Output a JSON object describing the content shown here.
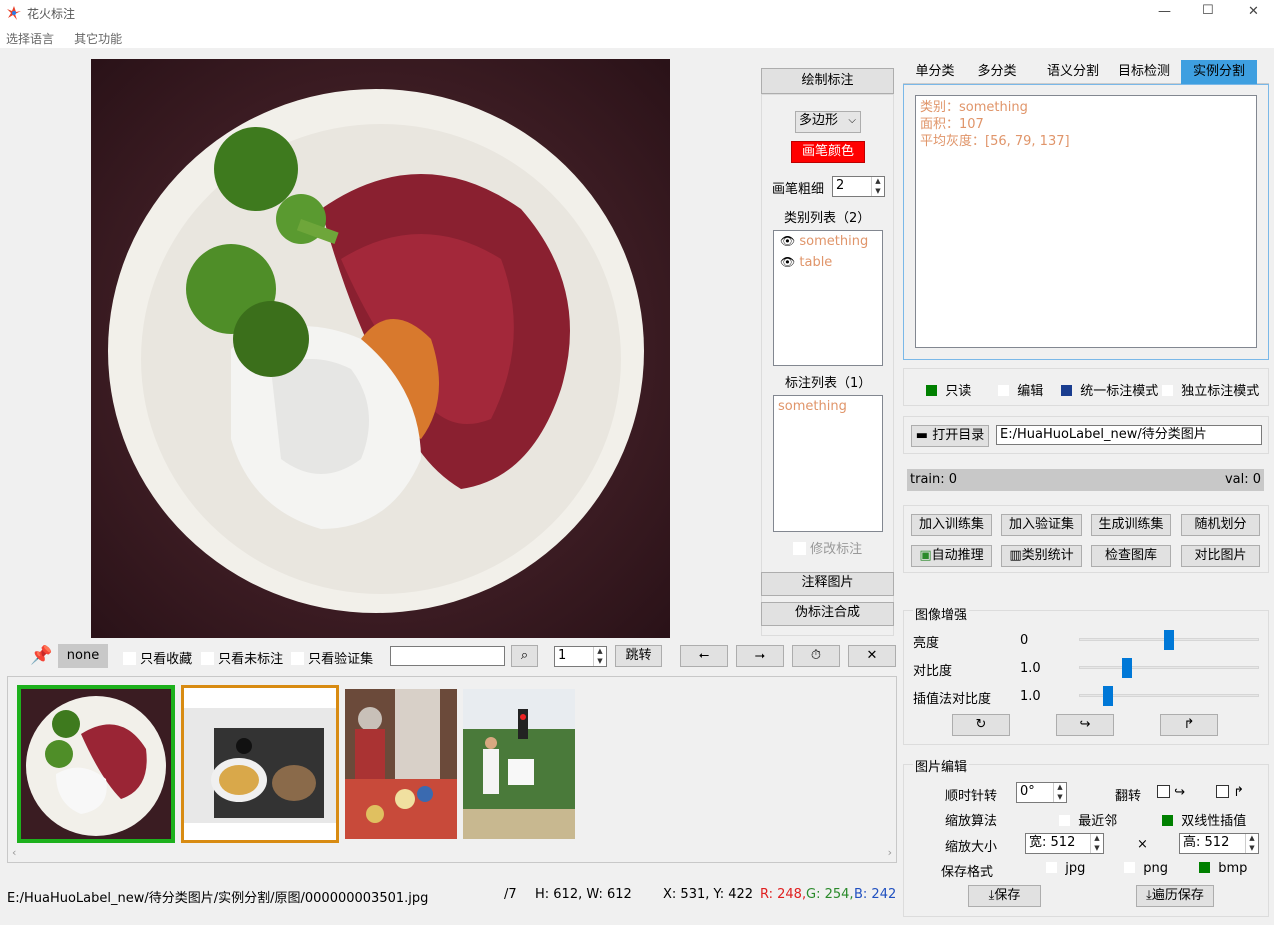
{
  "window": {
    "title": "花火标注",
    "minimize": "—",
    "maximize": "☐",
    "close": "✕"
  },
  "menu": {
    "language": "选择语言",
    "other": "其它功能"
  },
  "draw_panel": {
    "header": "绘制标注",
    "shape": "多边形",
    "brush_color_label": "画笔颜色",
    "brush_width_label": "画笔粗细",
    "brush_width": "2",
    "class_list_title": "类别列表（2）",
    "classes": [
      "something",
      "table"
    ],
    "annotation_list_title": "标注列表（1）",
    "annotations": [
      "something"
    ],
    "modify_label": "修改标注",
    "annotate_image": "注释图片",
    "pseudo_label": "伪标注合成"
  },
  "tabs": [
    "单分类",
    "多分类",
    "语义分割",
    "目标检测",
    "实例分割"
  ],
  "info": {
    "line1": "类别：something",
    "line2": "面积：107",
    "line3": "平均灰度：[56, 79, 137]"
  },
  "modes": {
    "readonly": "只读",
    "edit": "编辑",
    "unified": "统一标注模式",
    "independent": "独立标注模式"
  },
  "directory": {
    "open_label": "打开目录",
    "path": "E:/HuaHuoLabel_new/待分类图片"
  },
  "split": {
    "train": "train: 0",
    "val": "val: 0"
  },
  "actions": {
    "add_train": "加入训练集",
    "add_val": "加入验证集",
    "gen_train": "生成训练集",
    "random_split": "随机划分",
    "auto_infer": "自动推理",
    "class_stats": "类别统计",
    "check_gallery": "检查图库",
    "compare": "对比图片"
  },
  "enhance": {
    "title": "图像增强",
    "brightness_label": "亮度",
    "brightness": "0",
    "brightness_pos": 0.5,
    "contrast_label": "对比度",
    "contrast": "1.0",
    "contrast_pos": 0.25,
    "interp_label": "插值法对比度",
    "interp": "1.0",
    "interp_pos": 0.14
  },
  "edit": {
    "title": "图片编辑",
    "rotate_label": "顺时针转",
    "rotate": "0°",
    "flip_label": "翻转",
    "scale_algo_label": "缩放算法",
    "nearest": "最近邻",
    "bilinear": "双线性插值",
    "scale_size_label": "缩放大小",
    "width_label": "宽:",
    "width": "512",
    "times": "×",
    "height_label": "高:",
    "height": "512",
    "format_label": "保存格式",
    "jpg": "jpg",
    "png": "png",
    "bmp": "bmp",
    "save": "保存",
    "batch_save": "遍历保存"
  },
  "filter_bar": {
    "tag": "none",
    "only_fav": "只看收藏",
    "only_unlabeled": "只看未标注",
    "only_val": "只看验证集",
    "search": "",
    "page": "1",
    "jump": "跳转"
  },
  "status": {
    "path": "E:/HuaHuoLabel_new/待分类图片/实例分割/原图/000000003501.jpg",
    "count": "/7",
    "size": "H: 612, W: 612",
    "coords": "X: 531, Y: 422",
    "r": "R: 248,",
    "g": "G: 254,",
    "b": "B: 242"
  },
  "colors": {
    "accent": "#0078d7",
    "tab_active": "#3e9fe0",
    "brush": "#ff0000",
    "green": "#008000",
    "navy": "#1a3d8f",
    "label_orange": "#e0956a"
  }
}
